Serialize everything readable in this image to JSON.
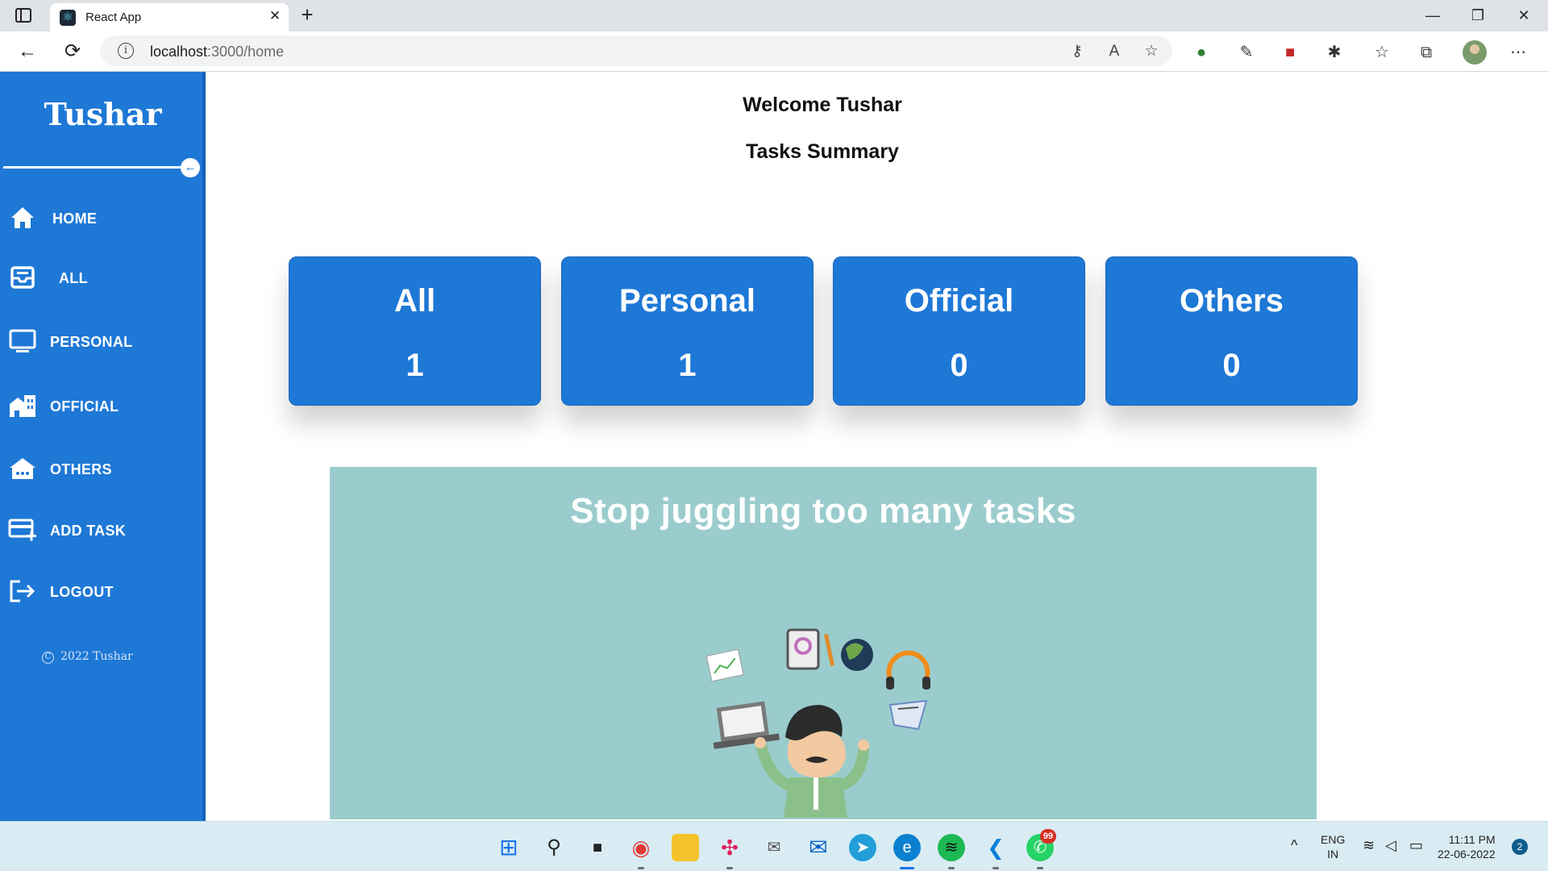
{
  "browser": {
    "tab_title": "React App",
    "tab_favicon": "react-icon",
    "url_host": "localhost",
    "url_path": ":3000/home"
  },
  "sidebar": {
    "brand": "Tushar",
    "items": [
      {
        "label": "HOME",
        "icon": "home-icon"
      },
      {
        "label": "ALL",
        "icon": "inbox-tray-icon"
      },
      {
        "label": "PERSONAL",
        "icon": "monitor-icon"
      },
      {
        "label": "OFFICIAL",
        "icon": "office-building-icon"
      },
      {
        "label": "OTHERS",
        "icon": "store-awning-icon"
      },
      {
        "label": "ADD TASK",
        "icon": "card-add-icon"
      },
      {
        "label": "LOGOUT",
        "icon": "logout-icon"
      }
    ],
    "footer": "2022 Tushar"
  },
  "main": {
    "welcome": "Welcome Tushar",
    "summary_title": "Tasks Summary",
    "cards": [
      {
        "title": "All",
        "count": "1"
      },
      {
        "title": "Personal",
        "count": "1"
      },
      {
        "title": "Official",
        "count": "0"
      },
      {
        "title": "Others",
        "count": "0"
      }
    ],
    "banner_text": "Stop juggling too many tasks"
  },
  "taskbar": {
    "lang_line1": "ENG",
    "lang_line2": "IN",
    "time": "11:11 PM",
    "date": "22-06-2022",
    "notification_count": "2",
    "whatsapp_badge": "99"
  },
  "colors": {
    "sidebar": "#1e78d6",
    "card": "#1e78d6",
    "banner": "#9bcccd"
  }
}
